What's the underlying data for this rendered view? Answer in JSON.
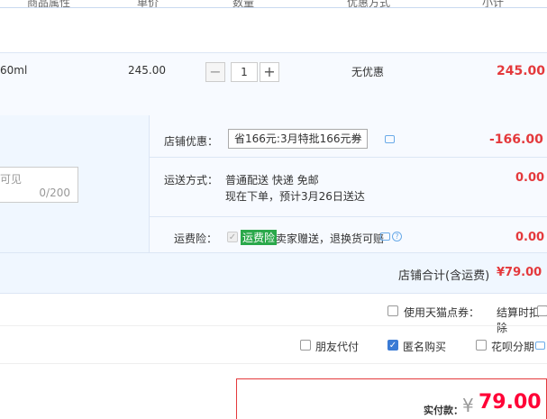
{
  "header": {
    "col_attr": "商品属性",
    "col_price": "单价",
    "col_qty": "数量",
    "col_discount": "优惠方式",
    "col_subtotal": "小计"
  },
  "item": {
    "attr": "60ml",
    "price": "245.00",
    "qty_minus": "−",
    "qty": "1",
    "qty_plus": "+",
    "discount": "无优惠",
    "subtotal": "245.00"
  },
  "message": {
    "placeholder_tail": "可见",
    "counter": "0/200"
  },
  "shop_discount": {
    "label": "店铺优惠：",
    "selected": "省166元:3月特批166元券",
    "amount": "-166.00"
  },
  "shipping": {
    "label": "运送方式：",
    "line1": "普通配送 快递 免邮",
    "line2": "现在下单，预计3月26日送达",
    "amount": "0.00"
  },
  "insurance": {
    "label": "运费险：",
    "badge": "运费险",
    "text": "卖家赠送，退换货可赔",
    "amount": "0.00"
  },
  "shop_total": {
    "label": "店铺合计(含运费)",
    "amount": "¥79.00"
  },
  "tmall_coupon": {
    "label": "使用天猫点券：",
    "note": "结算时扣除"
  },
  "options": {
    "friend_pay": "朋友代付",
    "anonymous": "匿名购买",
    "huabei": "花呗分期"
  },
  "payment": {
    "label": "实付款：",
    "currency": "¥",
    "amount": "79.00"
  },
  "colors": {
    "accent_red": "#e4393c",
    "link_blue": "#3a7bd5",
    "badge_green": "#2aa84a"
  }
}
